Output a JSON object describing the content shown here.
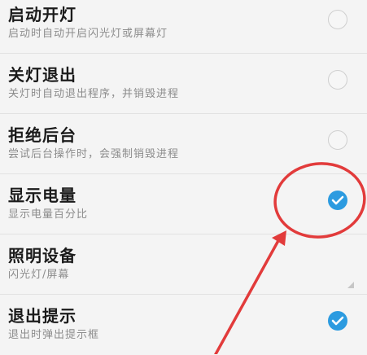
{
  "settings": [
    {
      "title": "启动开灯",
      "subtitle": "启动时自动开启闪光灯或屏幕灯",
      "control": "checkbox",
      "checked": false
    },
    {
      "title": "关灯退出",
      "subtitle": "关灯时自动退出程序，并销毁进程",
      "control": "checkbox",
      "checked": false
    },
    {
      "title": "拒绝后台",
      "subtitle": "尝试后台操作时，会强制销毁进程",
      "control": "checkbox",
      "checked": false
    },
    {
      "title": "显示电量",
      "subtitle": "显示电量百分比",
      "control": "checkbox",
      "checked": true
    },
    {
      "title": "照明设备",
      "subtitle": "闪光灯/屏幕",
      "control": "dropdown"
    },
    {
      "title": "退出提示",
      "subtitle": "退出时弹出提示框",
      "control": "checkbox",
      "checked": true
    }
  ],
  "colors": {
    "checked": "#2c9be0",
    "annotation": "#e23b3b",
    "background": "#f4f4f4"
  },
  "icons": {
    "checkmark": "check-icon",
    "dropdown": "dropdown-triangle-icon"
  }
}
